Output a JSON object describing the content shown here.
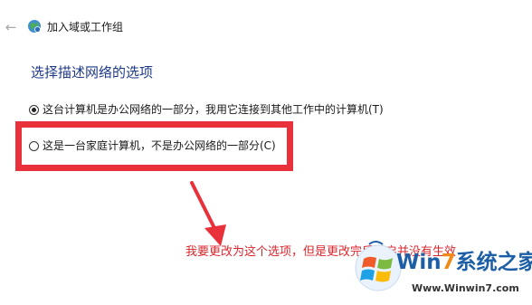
{
  "header": {
    "back_icon": "back-arrow-icon",
    "wizard_icon": "network-globe-icon",
    "title": "加入域或工作组"
  },
  "main": {
    "heading": "选择描述网络的选项",
    "options": [
      {
        "label": "这台计算机是办公网络的一部分，我用它连接到其他工作中的计算机(T)",
        "selected": true
      },
      {
        "label": "这是一台家庭计算机，不是办公网络的一部分(C)",
        "selected": false
      }
    ]
  },
  "annotation": {
    "text": "我要更改为这个选项，但是更改完后重启并没有生效",
    "color": "#e8313a"
  },
  "watermark": {
    "brand_prefix": "Win",
    "brand_seven": "7",
    "brand_suffix": "系统之家",
    "url": "Www.Winwin7.com",
    "logo_icon": "windows-flag-icon"
  },
  "colors": {
    "heading": "#1f3a8a",
    "accent_red": "#e8313a",
    "brand_blue": "#1d5fa6",
    "brand_orange": "#f28a1a"
  }
}
